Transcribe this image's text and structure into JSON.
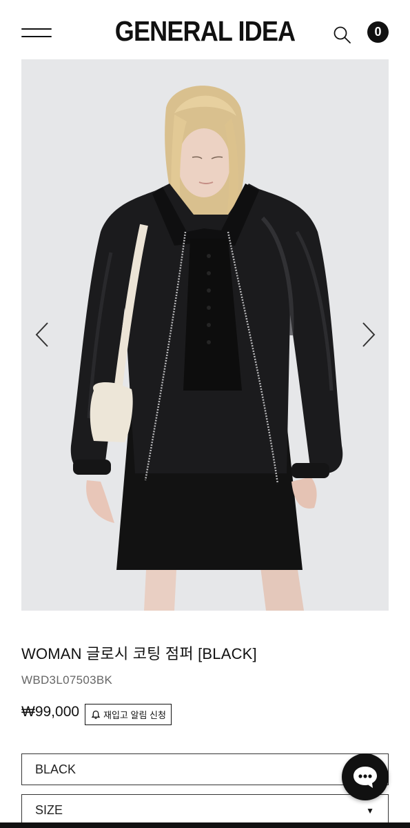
{
  "header": {
    "logo": "GENERAL IDEA",
    "cart_count": "0"
  },
  "product": {
    "title": "WOMAN 글로시 코팅 점퍼 [BLACK]",
    "sku": "WBD3L07503BK",
    "price": "₩99,000",
    "restock_label": "재입고 알림 신청"
  },
  "options": {
    "color_value": "BLACK",
    "size_placeholder": "SIZE"
  },
  "icons": {
    "menu": "hamburger-icon",
    "search": "search-icon",
    "cart": "cart-count-badge",
    "prev": "chevron-left-icon",
    "next": "chevron-right-icon",
    "bell": "bell-icon",
    "chat": "chat-bubble-icon",
    "caret": "caret-down-icon"
  },
  "colors": {
    "primary": "#111111",
    "background": "#ffffff",
    "muted_text": "#666666"
  }
}
